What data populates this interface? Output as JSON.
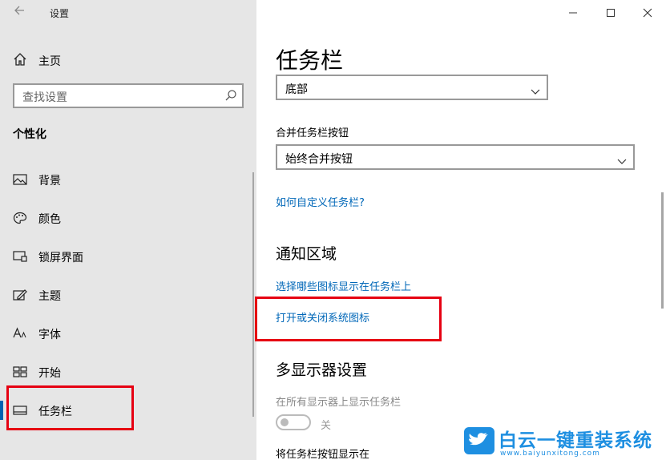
{
  "window": {
    "title": "设置"
  },
  "sidebar": {
    "home_label": "主页",
    "search_placeholder": "查找设置",
    "section_title": "个性化",
    "items": [
      {
        "label": "背景",
        "icon": "image-icon"
      },
      {
        "label": "颜色",
        "icon": "palette-icon"
      },
      {
        "label": "锁屏界面",
        "icon": "lock-screen-icon"
      },
      {
        "label": "主题",
        "icon": "theme-brush-icon"
      },
      {
        "label": "字体",
        "icon": "font-icon"
      },
      {
        "label": "开始",
        "icon": "start-grid-icon"
      },
      {
        "label": "任务栏",
        "icon": "taskbar-icon",
        "active": true
      }
    ]
  },
  "main": {
    "title": "任务栏",
    "position_dropdown_value": "底部",
    "combine_label": "合并任务栏按钮",
    "combine_dropdown_value": "始终合并按钮",
    "customize_link": "如何自定义任务栏?",
    "notification_heading": "通知区域",
    "select_icons_link": "选择哪些图标显示在任务栏上",
    "system_icons_link": "打开或关闭系统图标",
    "multi_display_heading": "多显示器设置",
    "show_all_displays_label": "在所有显示器上显示任务栏",
    "toggle_state": "关",
    "show_buttons_label": "将任务栏按钮显示在"
  },
  "watermark": {
    "brand": "白云一键重装系统",
    "url": "www.baiyunxitong.com"
  },
  "colors": {
    "accent": "#0063b1",
    "link": "#0067b8",
    "highlight": "#e60012",
    "sidebar_bg": "#e6e6e6"
  }
}
